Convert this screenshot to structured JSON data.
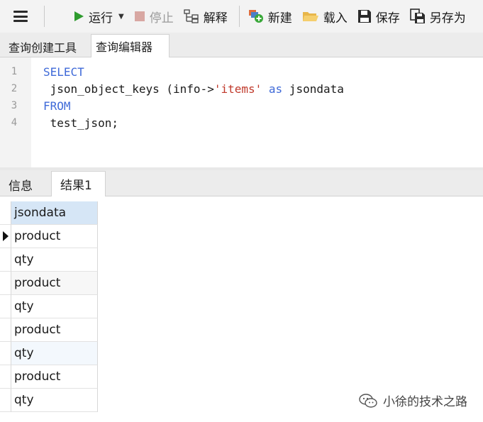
{
  "toolbar": {
    "run_label": "运行",
    "stop_label": "停止",
    "explain_label": "解释",
    "new_label": "新建",
    "load_label": "载入",
    "save_label": "保存",
    "save_as_label": "另存为"
  },
  "editor_tabs": [
    "查询创建工具",
    "查询编辑器"
  ],
  "code": {
    "line_numbers": [
      "1",
      "2",
      "3",
      "4"
    ],
    "line1": "SELECT",
    "line2_a": " json_object_keys (info->",
    "line2_str": "'items'",
    "line2_space": " ",
    "line2_kw": "as",
    "line2_b": " jsondata",
    "line3": "FROM",
    "line4": " test_json;"
  },
  "result_tabs": [
    "信息",
    "结果1"
  ],
  "grid": {
    "column": "jsondata",
    "rows": [
      "product",
      "qty",
      "product",
      "qty",
      "product",
      "qty",
      "product",
      "qty"
    ]
  },
  "watermark": "小徐的技术之路",
  "colors": {
    "keyword": "#3f6ad8",
    "string": "#c0392b",
    "run_green": "#2e9b2e",
    "stop_red": "#d8a7a2",
    "header_blue": "#d6e6f6"
  }
}
